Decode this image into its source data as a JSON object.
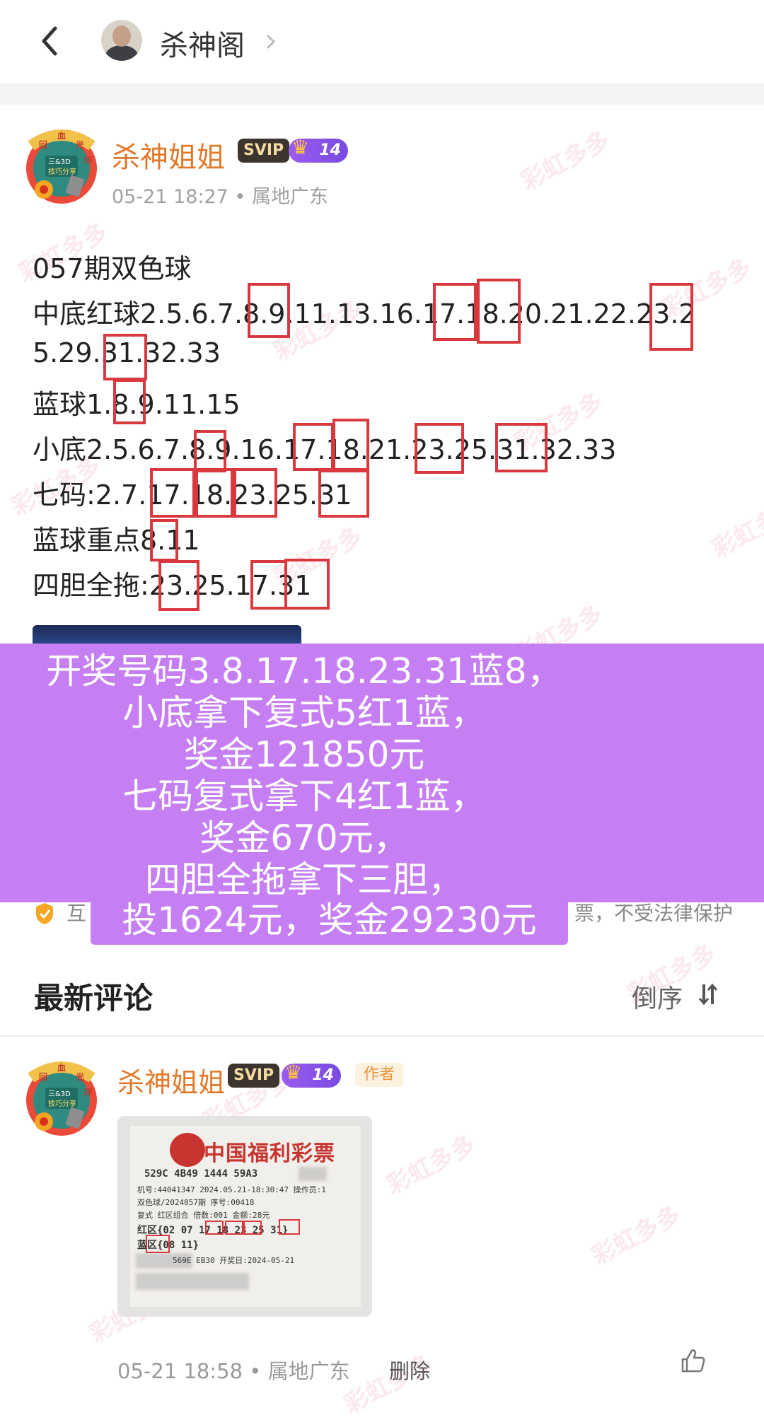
{
  "header": {
    "title": "杀神阁"
  },
  "post": {
    "author": "杀神姐姐",
    "svip": "SVIP",
    "level": "14",
    "avatar_text": [
      "回",
      "血",
      "光",
      "环",
      "三&3D",
      "技巧分享"
    ],
    "meta": "05-21 18:27 • 属地广东",
    "lines": [
      "057期双色球",
      "中底红球2.5.6.7.8.9.11.13.16.17.18.20.21.22.23.2",
      "5.29.31.32.33",
      "蓝球1.8.9.11.15",
      "小底2.5.6.7.8.9.16.17.18.21.23.25.31.32.33",
      "七码:2.7.17.18.23.25.31",
      "蓝球重点8.11",
      "四胆全拖:23.25.17.31"
    ]
  },
  "overlay": {
    "lines": [
      "开奖号码3.8.17.18.23.31蓝8，",
      "小底拿下复式5红1蓝，",
      "奖金121850元",
      "七码复式拿下4红1蓝，",
      "奖金670元，",
      "四胆全拖拿下三胆，",
      "投1624元，奖金29230元"
    ]
  },
  "disclaimer": {
    "left": "互",
    "right": "票，不受法律保护"
  },
  "comments": {
    "title": "最新评论",
    "sort_label": "倒序",
    "items": [
      {
        "author": "杀神姐姐",
        "svip": "SVIP",
        "level": "14",
        "tag": "作者",
        "meta": "05-21 18:58 • 属地广东",
        "delete": "删除",
        "ticket": {
          "brand": "中国福利彩票",
          "line1": "529C 4B49 1444 59A3",
          "line2": "机号:44041347 2024.05.21-18:30:47 操作员:1",
          "line3": "双色球/2024057期              序号:00418",
          "line4": "复式      红区组合  倍数:001  金额:28元",
          "line5": "红区{02 07  17  18  23  25  31}",
          "line6": "蓝区{08 11}",
          "line7": "    569E EB30 开奖日:2024-05-21"
        }
      }
    ]
  },
  "watermark": "彩虹多多",
  "colors": {
    "name": "#e2792a",
    "overlay": "#c57ff2",
    "mark": "#d9383f"
  }
}
